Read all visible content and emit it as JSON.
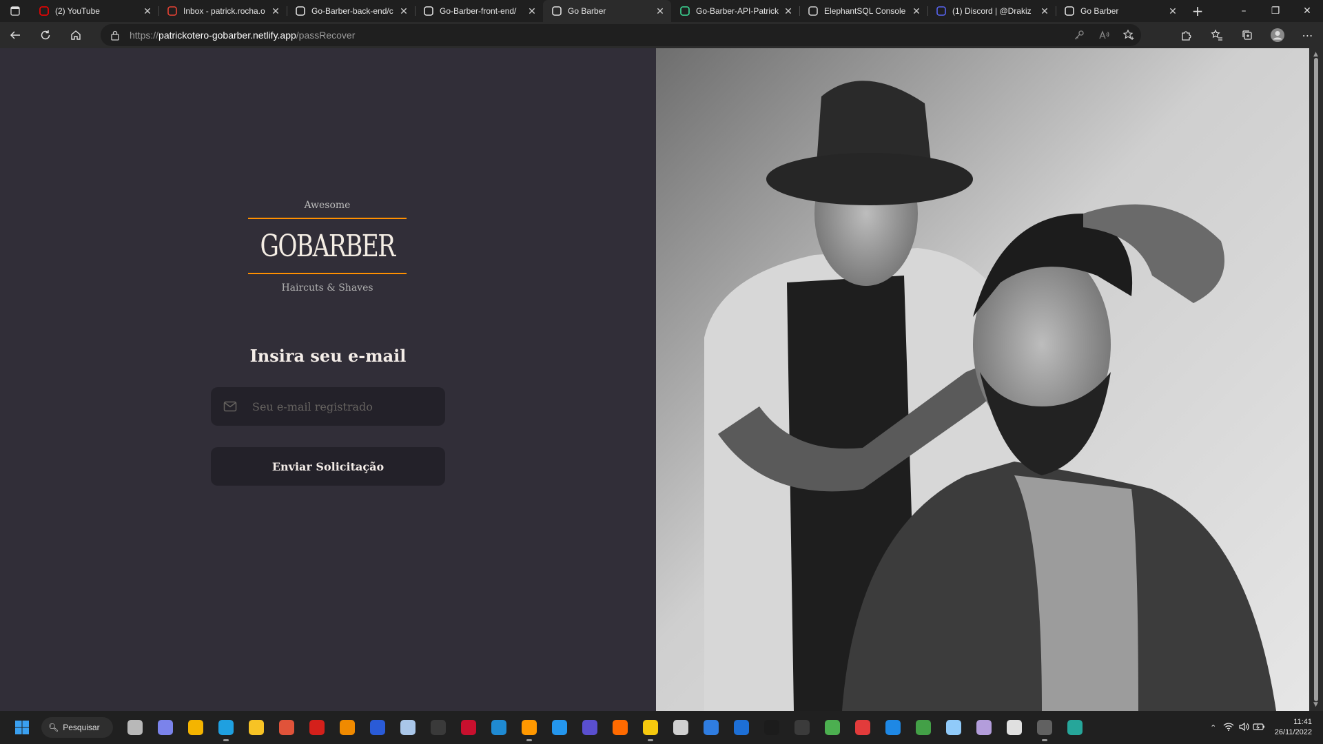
{
  "browser": {
    "tabs": [
      {
        "title": "(2) YouTube",
        "icon": "youtube-icon",
        "color": "#ff0000",
        "active": false
      },
      {
        "title": "Inbox - patrick.rocha.o",
        "icon": "gmail-icon",
        "color": "#ea4335",
        "active": false
      },
      {
        "title": "Go-Barber-back-end/c",
        "icon": "github-icon",
        "color": "#e0e0e0",
        "active": false
      },
      {
        "title": "Go-Barber-front-end/",
        "icon": "github-icon",
        "color": "#e0e0e0",
        "active": false
      },
      {
        "title": "Go Barber",
        "icon": "page-icon",
        "color": "#e0e0e0",
        "active": true
      },
      {
        "title": "Go-Barber-API-Patrick",
        "icon": "code-page-icon",
        "color": "#3ddc97",
        "active": false
      },
      {
        "title": "ElephantSQL Console",
        "icon": "elephant-icon",
        "color": "#cfcfcf",
        "active": false
      },
      {
        "title": "(1) Discord | @Drakiz",
        "icon": "discord-icon",
        "color": "#5865f2",
        "active": false
      },
      {
        "title": "Go Barber",
        "icon": "page-icon",
        "color": "#e0e0e0",
        "active": false
      }
    ],
    "url": {
      "protocol": "https://",
      "host": "patrickotero-gobarber.netlify.app",
      "path": "/passRecover"
    }
  },
  "page": {
    "logo": {
      "top_text": "Awesome",
      "brand": "GOBARBER",
      "tagline": "Haircuts & Shaves",
      "accent": "#ff9000"
    },
    "form": {
      "title": "Insira seu e-mail",
      "email_placeholder": "Seu e-mail registrado",
      "email_value": "",
      "submit_label": "Enviar Solicitação"
    },
    "hero_image": "barber-cutting-hair-photo"
  },
  "taskbar": {
    "search_label": "Pesquisar",
    "apps": [
      {
        "name": "task-view",
        "color": "#b8b8b8",
        "running": false
      },
      {
        "name": "teams-chat",
        "color": "#7b83eb",
        "running": false
      },
      {
        "name": "chrome",
        "color": "#f4b400",
        "running": false
      },
      {
        "name": "edge",
        "color": "#1fa0e0",
        "running": true
      },
      {
        "name": "file-explorer",
        "color": "#f7c325",
        "running": false
      },
      {
        "name": "app-red-swirl",
        "color": "#e0533a",
        "running": false
      },
      {
        "name": "acrobat",
        "color": "#d4201b",
        "running": false
      },
      {
        "name": "vlc",
        "color": "#f08a00",
        "running": false
      },
      {
        "name": "bitwarden",
        "color": "#2a5bd7",
        "running": false
      },
      {
        "name": "notepad",
        "color": "#a9c6e8",
        "running": false
      },
      {
        "name": "terminal",
        "color": "#3a3a3a",
        "running": false
      },
      {
        "name": "dev-cpp",
        "color": "#c8102e",
        "running": false
      },
      {
        "name": "vscode",
        "color": "#1f8ad2",
        "running": false
      },
      {
        "name": "sublime",
        "color": "#ff9800",
        "running": true
      },
      {
        "name": "docker",
        "color": "#2496ed",
        "running": false
      },
      {
        "name": "app-purple",
        "color": "#5a4fcf",
        "running": false
      },
      {
        "name": "app-orange-bars",
        "color": "#ff6a00",
        "running": false
      },
      {
        "name": "app-yellow",
        "color": "#f6c90e",
        "running": true
      },
      {
        "name": "magnifier",
        "color": "#d0d0d0",
        "running": false
      },
      {
        "name": "app-blue-circle",
        "color": "#2f7de1",
        "running": false
      },
      {
        "name": "app-globe",
        "color": "#1d6fd6",
        "running": false
      },
      {
        "name": "app-dark",
        "color": "#1c1c1c",
        "running": false
      },
      {
        "name": "app-iv",
        "color": "#3b3b3b",
        "running": false
      },
      {
        "name": "app-green-leaf",
        "color": "#4caf50",
        "running": false
      },
      {
        "name": "app-red-blue",
        "color": "#e23b3b",
        "running": false
      },
      {
        "name": "app-blue-arrow",
        "color": "#1e88e5",
        "running": false
      },
      {
        "name": "app-green",
        "color": "#43a047",
        "running": false
      },
      {
        "name": "app-monitor",
        "color": "#90caf9",
        "running": false
      },
      {
        "name": "app-cube",
        "color": "#b39ddb",
        "running": false
      },
      {
        "name": "app-bw",
        "color": "#e0e0e0",
        "running": false
      },
      {
        "name": "app-console",
        "color": "#616161",
        "running": true
      },
      {
        "name": "app-earth",
        "color": "#26a69a",
        "running": false
      }
    ],
    "time": "11:41",
    "date": "26/11/2022"
  }
}
